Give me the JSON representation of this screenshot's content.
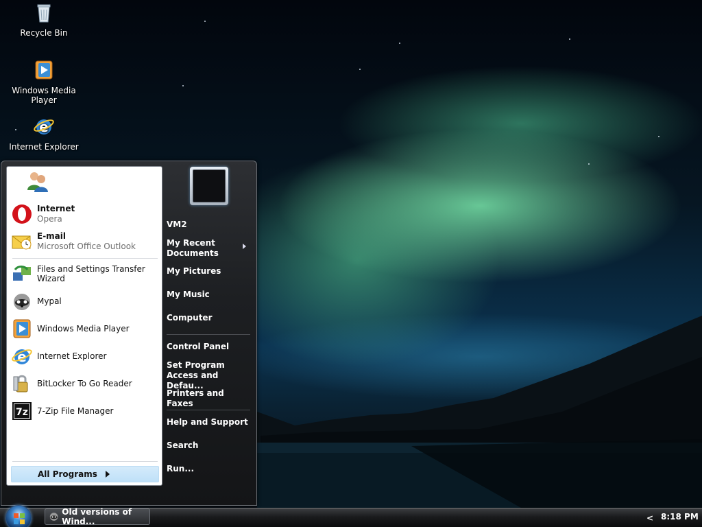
{
  "desktop": {
    "icons": [
      {
        "label": "Recycle Bin",
        "icon": "recycle-bin-icon"
      },
      {
        "label": "Windows Media Player",
        "icon": "media-player-icon"
      },
      {
        "label": "Internet Explorer",
        "icon": "internet-explorer-icon"
      }
    ]
  },
  "start_menu": {
    "pinned": [
      {
        "title": "Internet",
        "subtitle": "Opera",
        "icon": "opera-icon"
      },
      {
        "title": "E-mail",
        "subtitle": "Microsoft Office Outlook",
        "icon": "outlook-icon"
      }
    ],
    "recent": [
      {
        "label": "Files and Settings Transfer Wizard",
        "icon": "transfer-wizard-icon"
      },
      {
        "label": "Mypal",
        "icon": "mypal-icon"
      },
      {
        "label": "Windows Media Player",
        "icon": "media-player-icon"
      },
      {
        "label": "Internet Explorer",
        "icon": "internet-explorer-icon"
      },
      {
        "label": "BitLocker To Go Reader",
        "icon": "bitlocker-icon"
      },
      {
        "label": "7-Zip File Manager",
        "icon": "seven-zip-icon"
      }
    ],
    "all_programs": "All Programs",
    "right": {
      "user": "VM2",
      "recent_docs": "My Recent Documents",
      "pictures": "My Pictures",
      "music": "My Music",
      "computer": "Computer",
      "control_panel": "Control Panel",
      "set_program": "Set Program Access and Defau...",
      "printers": "Printers and Faxes",
      "help": "Help and Support",
      "search": "Search",
      "run": "Run..."
    }
  },
  "taskbar": {
    "window_button": "Old versions of Wind...",
    "tray_arrow": "<",
    "clock": "8:18 PM"
  },
  "colors": {
    "menu_dark": "#1d1f22",
    "menu_highlight": "#bfe0f8",
    "taskbar": "#1a1b1d"
  }
}
